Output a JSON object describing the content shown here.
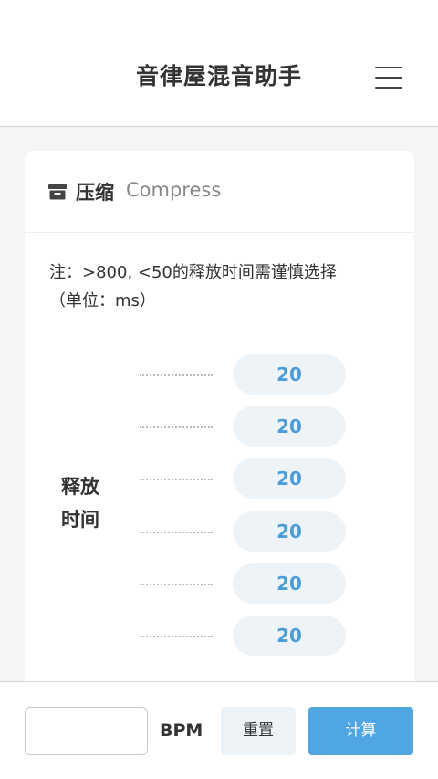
{
  "header": {
    "title": "音律屋混音助手",
    "menu_icon": "hamburger-menu-icon"
  },
  "card": {
    "icon": "archive-box-icon",
    "title": "压缩",
    "subtitle": "Compress",
    "note_line1": "注：>800, <50的释放时间需谨慎选择",
    "note_line2": "（单位：ms）",
    "side_label_line1": "释放",
    "side_label_line2": "时间",
    "values": [
      "20",
      "20",
      "20",
      "20",
      "20",
      "20"
    ]
  },
  "bottom": {
    "bpm_value": "",
    "bpm_placeholder": "",
    "bpm_label": "BPM",
    "reset_label": "重置",
    "calc_label": "计算"
  },
  "colors": {
    "accent": "#4fa6e2",
    "value_text": "#4b9ed8",
    "pill_bg": "#eef3f7"
  }
}
